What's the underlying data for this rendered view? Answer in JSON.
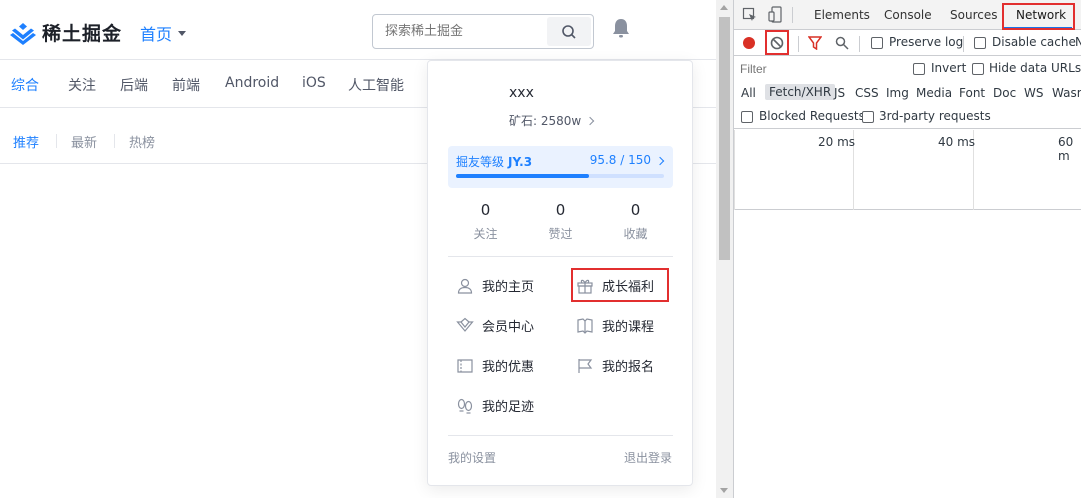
{
  "site": {
    "logo_text": "稀土掘金",
    "home_label": "首页",
    "search_placeholder": "探索稀土掘金",
    "nav": [
      "综合",
      "关注",
      "后端",
      "前端",
      "Android",
      "iOS",
      "人工智能"
    ],
    "subnav": [
      "推荐",
      "最新",
      "热榜"
    ]
  },
  "panel": {
    "username": "xxx",
    "ore": "矿石: 2580w",
    "level_label": "掘友等级",
    "level_value": "JY.3",
    "level_progress_text": "95.8 / 150",
    "level_progress": 0.639,
    "stats": [
      {
        "num": "0",
        "label": "关注"
      },
      {
        "num": "0",
        "label": "赞过"
      },
      {
        "num": "0",
        "label": "收藏"
      }
    ],
    "menu": {
      "my_home": "我的主页",
      "growth": "成长福利",
      "vip": "会员中心",
      "courses": "我的课程",
      "coupons": "我的优惠",
      "signup": "我的报名",
      "footprint": "我的足迹"
    },
    "settings": "我的设置",
    "logout": "退出登录"
  },
  "devtools": {
    "tabs": [
      "Elements",
      "Console",
      "Sources",
      "Network"
    ],
    "preserve_log": "Preserve log",
    "disable_cache": "Disable cache",
    "more": "N",
    "filter_placeholder": "Filter",
    "invert": "Invert",
    "hide_data_urls": "Hide data URLs",
    "types": [
      "All",
      "Fetch/XHR",
      "JS",
      "CSS",
      "Img",
      "Media",
      "Font",
      "Doc",
      "WS",
      "Wasm"
    ],
    "blocked_requests": "Blocked Requests",
    "third_party": "3rd-party requests",
    "timeline": [
      "20 ms",
      "40 ms",
      "60 m"
    ]
  },
  "colors": {
    "accent": "#1e80ff",
    "highlight": "#e22f2f"
  }
}
